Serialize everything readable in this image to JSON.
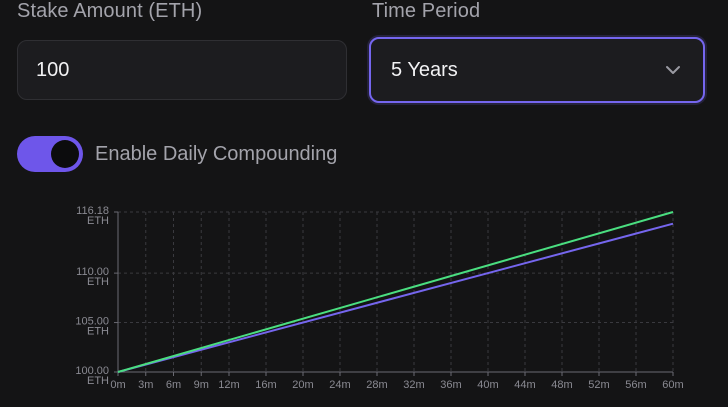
{
  "stake": {
    "label": "Stake Amount (ETH)",
    "value": "100"
  },
  "period": {
    "label": "Time Period",
    "selected": "5 Years"
  },
  "compounding": {
    "label": "Enable Daily Compounding",
    "enabled": true
  },
  "colors": {
    "accent": "#6e56ea",
    "compound_line": "#4ade80",
    "simple_line": "#7566ee"
  },
  "chart_data": {
    "type": "line",
    "x_unit": "months",
    "x_ticks": [
      "0m",
      "3m",
      "6m",
      "9m",
      "12m",
      "16m",
      "20m",
      "24m",
      "28m",
      "32m",
      "36m",
      "40m",
      "44m",
      "48m",
      "52m",
      "56m",
      "60m"
    ],
    "x_tick_values": [
      0,
      3,
      6,
      9,
      12,
      16,
      20,
      24,
      28,
      32,
      36,
      40,
      44,
      48,
      52,
      56,
      60
    ],
    "y_ticks": [
      {
        "value": 100.0,
        "label": "100.00",
        "unit": "ETH"
      },
      {
        "value": 105.0,
        "label": "105.00",
        "unit": "ETH"
      },
      {
        "value": 110.0,
        "label": "110.00",
        "unit": "ETH"
      },
      {
        "value": 116.18,
        "label": "116.18",
        "unit": "ETH"
      }
    ],
    "ylim": [
      100,
      116.18
    ],
    "xlim": [
      0,
      60
    ],
    "grid": true,
    "series": [
      {
        "x": [
          0,
          60
        ],
        "values": [
          100,
          116.18
        ]
      },
      {
        "x": [
          0,
          60
        ],
        "values": [
          100,
          115.0
        ]
      }
    ]
  }
}
